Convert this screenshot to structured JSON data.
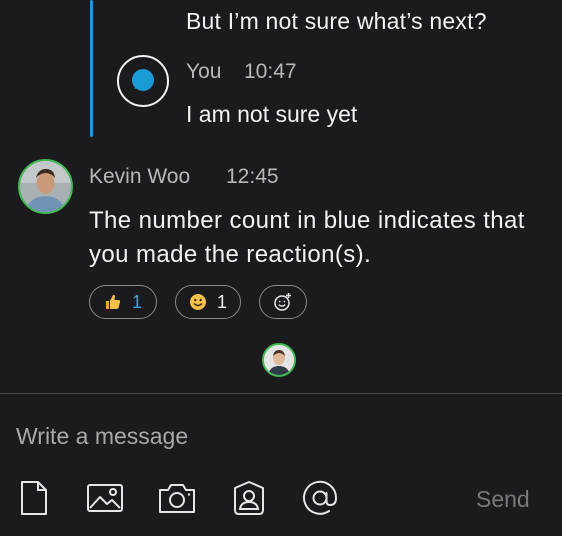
{
  "thread": {
    "previous_text": "But I’m not sure what’s next?",
    "reply": {
      "author": "You",
      "time": "10:47",
      "text": "I am not sure yet",
      "avatar_icon": "chat-bubble-icon"
    }
  },
  "message": {
    "author": "Kevin Woo",
    "time": "12:45",
    "text": "The number count in blue indicates that you made the reaction(s).",
    "reactions": [
      {
        "icon": "thumbs-up-emoji",
        "count": "1",
        "mine": true
      },
      {
        "icon": "smile-emoji",
        "count": "1",
        "mine": false
      },
      {
        "icon": "add-reaction-icon",
        "count": ""
      }
    ]
  },
  "composer": {
    "placeholder": "Write a message",
    "send_label": "Send",
    "tools": [
      "file-icon",
      "image-icon",
      "camera-icon",
      "contact-icon",
      "mention-icon"
    ]
  },
  "colors": {
    "background": "#1b1b1d",
    "thread_line": "#1a9ad6",
    "presence": "#3fb950",
    "own_reaction_count": "#3aa3e0"
  }
}
